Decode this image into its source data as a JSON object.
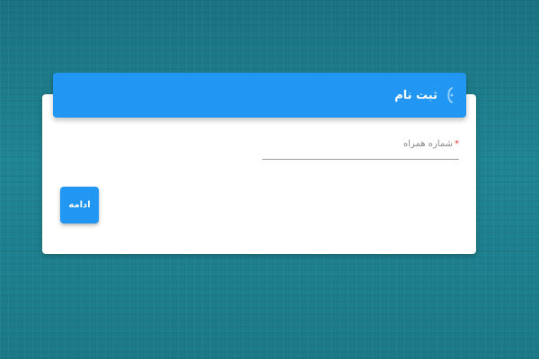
{
  "header": {
    "title": "ثبت نام",
    "icon": "sign-up-icon"
  },
  "form": {
    "phone_label": "شماره همراه",
    "required_mark": "*",
    "phone_value": ""
  },
  "actions": {
    "continue_label": "ادامه"
  },
  "colors": {
    "primary": "#2196f3",
    "background": "#1f7f8c",
    "required": "#e53935"
  }
}
